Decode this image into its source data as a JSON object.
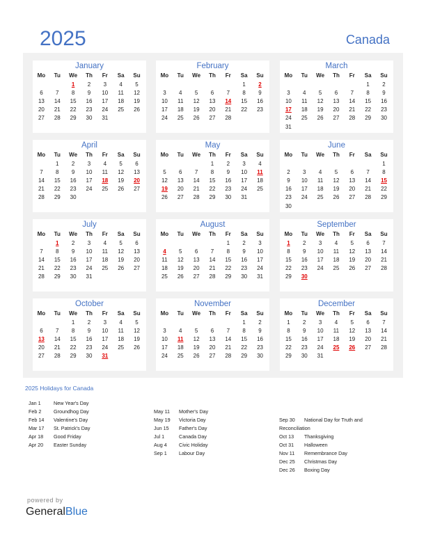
{
  "header": {
    "year": "2025",
    "country": "Canada"
  },
  "weekdays": [
    "Mo",
    "Tu",
    "We",
    "Th",
    "Fr",
    "Sa",
    "Su"
  ],
  "colors": {
    "accent": "#4472c4",
    "holiday": "#e00000",
    "panel_bg": "#f1f1f1"
  },
  "months": [
    {
      "name": "January",
      "start": 2,
      "days": 31,
      "holidays": [
        1
      ]
    },
    {
      "name": "February",
      "start": 5,
      "days": 28,
      "holidays": [
        2,
        14
      ]
    },
    {
      "name": "March",
      "start": 5,
      "days": 31,
      "holidays": [
        17
      ]
    },
    {
      "name": "April",
      "start": 1,
      "days": 30,
      "holidays": [
        18,
        20
      ]
    },
    {
      "name": "May",
      "start": 3,
      "days": 31,
      "holidays": [
        11,
        19
      ]
    },
    {
      "name": "June",
      "start": 6,
      "days": 30,
      "holidays": [
        15
      ]
    },
    {
      "name": "July",
      "start": 1,
      "days": 31,
      "holidays": [
        1
      ]
    },
    {
      "name": "August",
      "start": 4,
      "days": 31,
      "holidays": [
        4
      ]
    },
    {
      "name": "September",
      "start": 0,
      "days": 30,
      "holidays": [
        1,
        30
      ]
    },
    {
      "name": "October",
      "start": 2,
      "days": 31,
      "holidays": [
        13,
        31
      ]
    },
    {
      "name": "November",
      "start": 5,
      "days": 30,
      "holidays": [
        11
      ]
    },
    {
      "name": "December",
      "start": 0,
      "days": 31,
      "holidays": [
        25,
        26
      ]
    }
  ],
  "holidays_section": {
    "title": "2025 Holidays for Canada",
    "columns": [
      [
        {
          "date": "Jan 1",
          "name": "New Year's Day"
        },
        {
          "date": "Feb 2",
          "name": "Groundhog Day"
        },
        {
          "date": "Feb 14",
          "name": "Valentine's Day"
        },
        {
          "date": "Mar 17",
          "name": "St. Patrick's Day"
        },
        {
          "date": "Apr 18",
          "name": "Good Friday"
        },
        {
          "date": "Apr 20",
          "name": "Easter Sunday"
        }
      ],
      [
        {
          "date": "May 11",
          "name": "Mother's Day"
        },
        {
          "date": "May 19",
          "name": "Victoria Day"
        },
        {
          "date": "Jun 15",
          "name": "Father's Day"
        },
        {
          "date": "Jul 1",
          "name": "Canada Day"
        },
        {
          "date": "Aug 4",
          "name": "Civic Holiday"
        },
        {
          "date": "Sep 1",
          "name": "Labour Day"
        }
      ],
      [
        {
          "date": "Sep 30",
          "name": "National Day for Truth and",
          "name_cont": "Reconciliation"
        },
        {
          "date": "Oct 13",
          "name": "Thanksgiving"
        },
        {
          "date": "Oct 31",
          "name": "Halloween"
        },
        {
          "date": "Nov 11",
          "name": "Remembrance Day"
        },
        {
          "date": "Dec 25",
          "name": "Christmas Day"
        },
        {
          "date": "Dec 26",
          "name": "Boxing Day"
        }
      ]
    ]
  },
  "footer": {
    "powered_by": "powered by",
    "brand_part1": "General",
    "brand_part2": "Blue"
  }
}
